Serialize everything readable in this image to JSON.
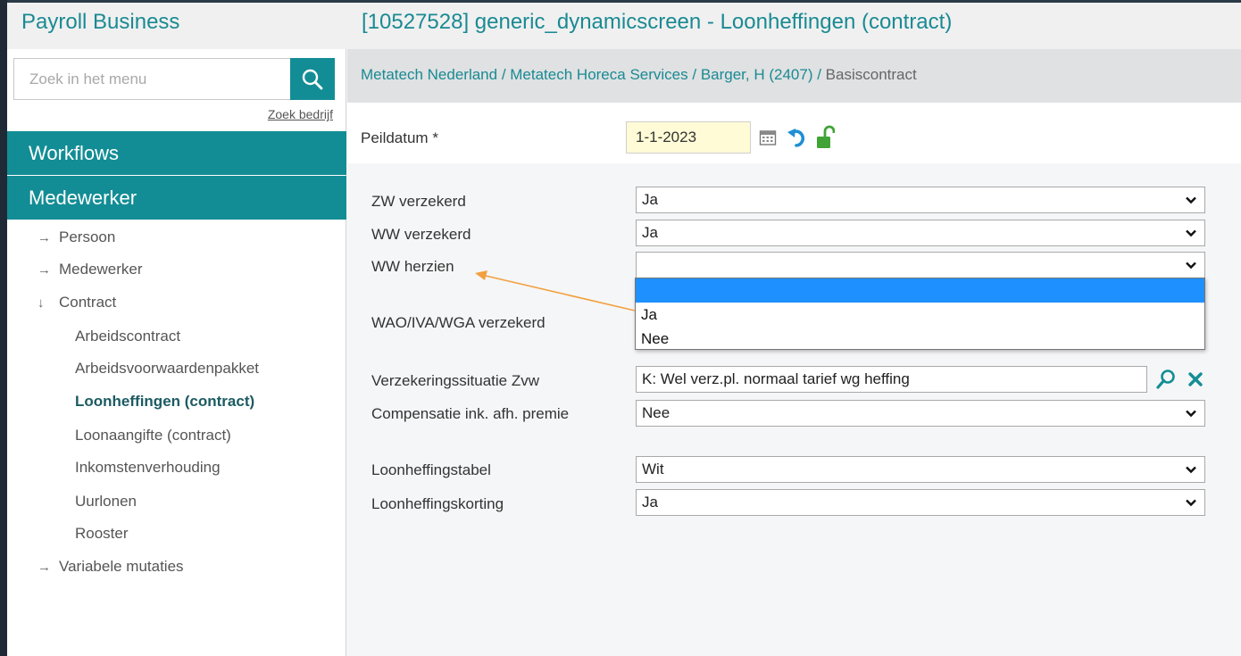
{
  "header": {
    "app_title": "Payroll Business",
    "page_title": "[10527528] generic_dynamicscreen - Loonheffingen (contract)"
  },
  "sidebar": {
    "search_placeholder": "Zoek in het menu",
    "zoek_bedrijf": "Zoek bedrijf",
    "sections": {
      "workflows": "Workflows",
      "medewerker": "Medewerker"
    },
    "items": [
      {
        "label": "Persoon",
        "arrow": "→"
      },
      {
        "label": "Medewerker",
        "arrow": "→"
      },
      {
        "label": "Contract",
        "arrow": "↓"
      },
      {
        "label": "Arbeidscontract"
      },
      {
        "label": "Arbeidsvoorwaardenpakket"
      },
      {
        "label": "Loonheffingen (contract)"
      },
      {
        "label": "Loonaangifte (contract)"
      },
      {
        "label": "Inkomstenverhouding"
      },
      {
        "label": "Uurlonen"
      },
      {
        "label": "Rooster"
      },
      {
        "label": "Variabele mutaties",
        "arrow": "→"
      }
    ]
  },
  "breadcrumb": {
    "items": [
      "Metatech Nederland",
      "Metatech Horeca Services",
      "Barger, H (2407)"
    ],
    "separator": " / ",
    "current": "Basiscontract"
  },
  "peildatum": {
    "label": "Peildatum *",
    "value": "1-1-2023"
  },
  "fields": {
    "zw_verzekerd": {
      "label": "ZW verzekerd",
      "value": "Ja"
    },
    "ww_verzekerd": {
      "label": "WW verzekerd",
      "value": "Ja"
    },
    "ww_herzien": {
      "label": "WW herzien",
      "value": ""
    },
    "wao_verzekerd": {
      "label": "WAO/IVA/WGA verzekerd"
    },
    "zvw": {
      "label": "Verzekeringssituatie Zvw",
      "value": "K: Wel verz.pl. normaal tarief wg heffing"
    },
    "compensatie": {
      "label": "Compensatie ink. afh. premie",
      "value": "Nee"
    },
    "loonheffingstabel": {
      "label": "Loonheffingstabel",
      "value": "Wit"
    },
    "loonheffingskorting": {
      "label": "Loonheffingskorting",
      "value": "Ja"
    }
  },
  "dropdown_options": [
    "",
    "Ja",
    "Nee"
  ],
  "colors": {
    "accent": "#138d95",
    "title": "#1a8a93",
    "highlight": "#1e90ff",
    "annotation": "#f2a040"
  }
}
